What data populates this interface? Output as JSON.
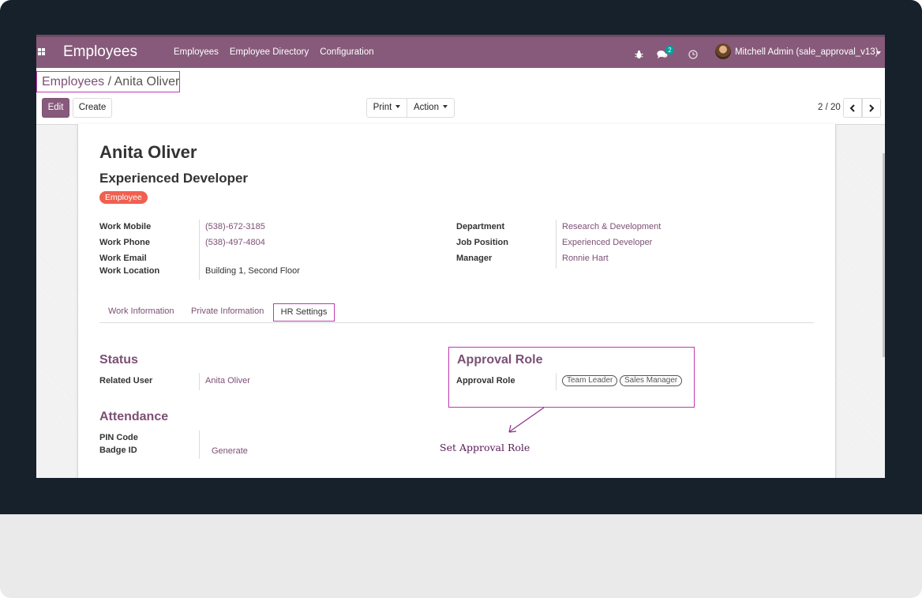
{
  "navbar": {
    "brand": "Employees",
    "menu": [
      "Employees",
      "Employee Directory",
      "Configuration"
    ],
    "message_count": "2",
    "user": "Mitchell Admin (sale_approval_v13)",
    "icons": [
      "apps-icon",
      "bug-icon",
      "chat-icon",
      "clock-icon",
      "avatar"
    ]
  },
  "breadcrumb": {
    "parent": "Employees",
    "separator": "/",
    "current": "Anita Oliver"
  },
  "control": {
    "edit": "Edit",
    "create": "Create",
    "print": "Print",
    "action": "Action",
    "pager": "2 / 20"
  },
  "employee": {
    "name": "Anita Oliver",
    "job_title": "Experienced Developer",
    "tag": "Employee"
  },
  "fields_left": [
    {
      "label": "Work Mobile",
      "value": "(538)-672-3185"
    },
    {
      "label": "Work Phone",
      "value": "(538)-497-4804"
    },
    {
      "label": "Work Email",
      "value": ""
    },
    {
      "label": "Work Location",
      "value": "Building 1, Second Floor"
    }
  ],
  "fields_right": [
    {
      "label": "Department",
      "value": "Research & Development"
    },
    {
      "label": "Job Position",
      "value": "Experienced Developer"
    },
    {
      "label": "Manager",
      "value": "Ronnie Hart"
    }
  ],
  "tabs": [
    "Work Information",
    "Private Information",
    "HR Settings"
  ],
  "status": {
    "title": "Status",
    "related_user_label": "Related User",
    "related_user_value": "Anita Oliver"
  },
  "attendance": {
    "title": "Attendance",
    "pin_label": "PIN Code",
    "badge_label": "Badge ID",
    "generate": "Generate"
  },
  "approval": {
    "title": "Approval Role",
    "label": "Approval Role",
    "roles": [
      "Team Leader",
      "Sales Manager"
    ]
  },
  "annotation": "Set Approval Role",
  "colors": {
    "navbar": "#875a7b",
    "link": "#7c5074",
    "highlight": "#c038b4",
    "tag": "#f06050"
  }
}
